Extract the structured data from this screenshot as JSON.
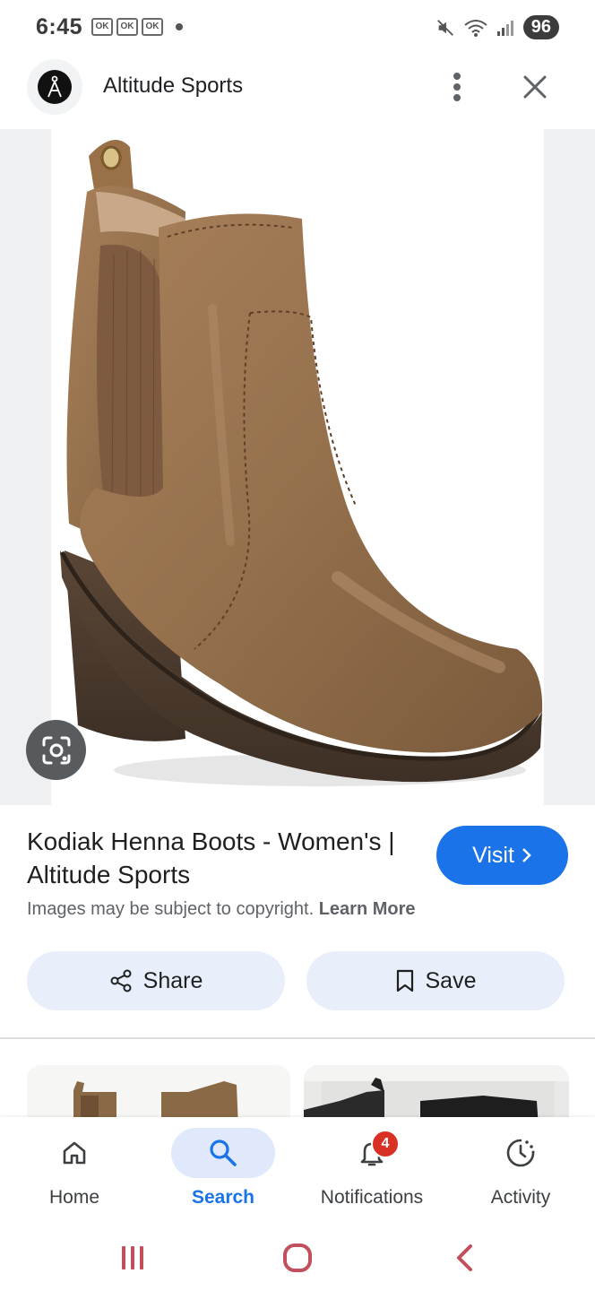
{
  "status_bar": {
    "time": "6:45",
    "notification_icons": [
      "OK",
      "OK",
      "OK"
    ],
    "battery": "96"
  },
  "header": {
    "site_name": "Altitude Sports",
    "logo_icon": "altitude-sports-logo",
    "menu_icon": "more-vertical-icon",
    "close_icon": "close-icon"
  },
  "image": {
    "subject": "brown leather chelsea boot",
    "lens_icon": "google-lens-icon"
  },
  "result": {
    "title": "Kodiak Henna Boots - Women's | Altitude Sports",
    "visit_label": "Visit",
    "copyright_text": "Images may be subject to copyright.",
    "learn_more_label": "Learn More"
  },
  "actions": {
    "share_label": "Share",
    "save_label": "Save"
  },
  "bottom_nav": {
    "items": [
      {
        "label": "Home",
        "icon": "home-icon"
      },
      {
        "label": "Search",
        "icon": "search-icon",
        "active": true
      },
      {
        "label": "Notifications",
        "icon": "bell-icon",
        "badge": "4"
      },
      {
        "label": "Activity",
        "icon": "activity-icon"
      }
    ]
  },
  "colors": {
    "accent": "#1a73e8",
    "action_bg": "#e8effb",
    "badge": "#d93025",
    "system_nav": "#c0505c"
  }
}
